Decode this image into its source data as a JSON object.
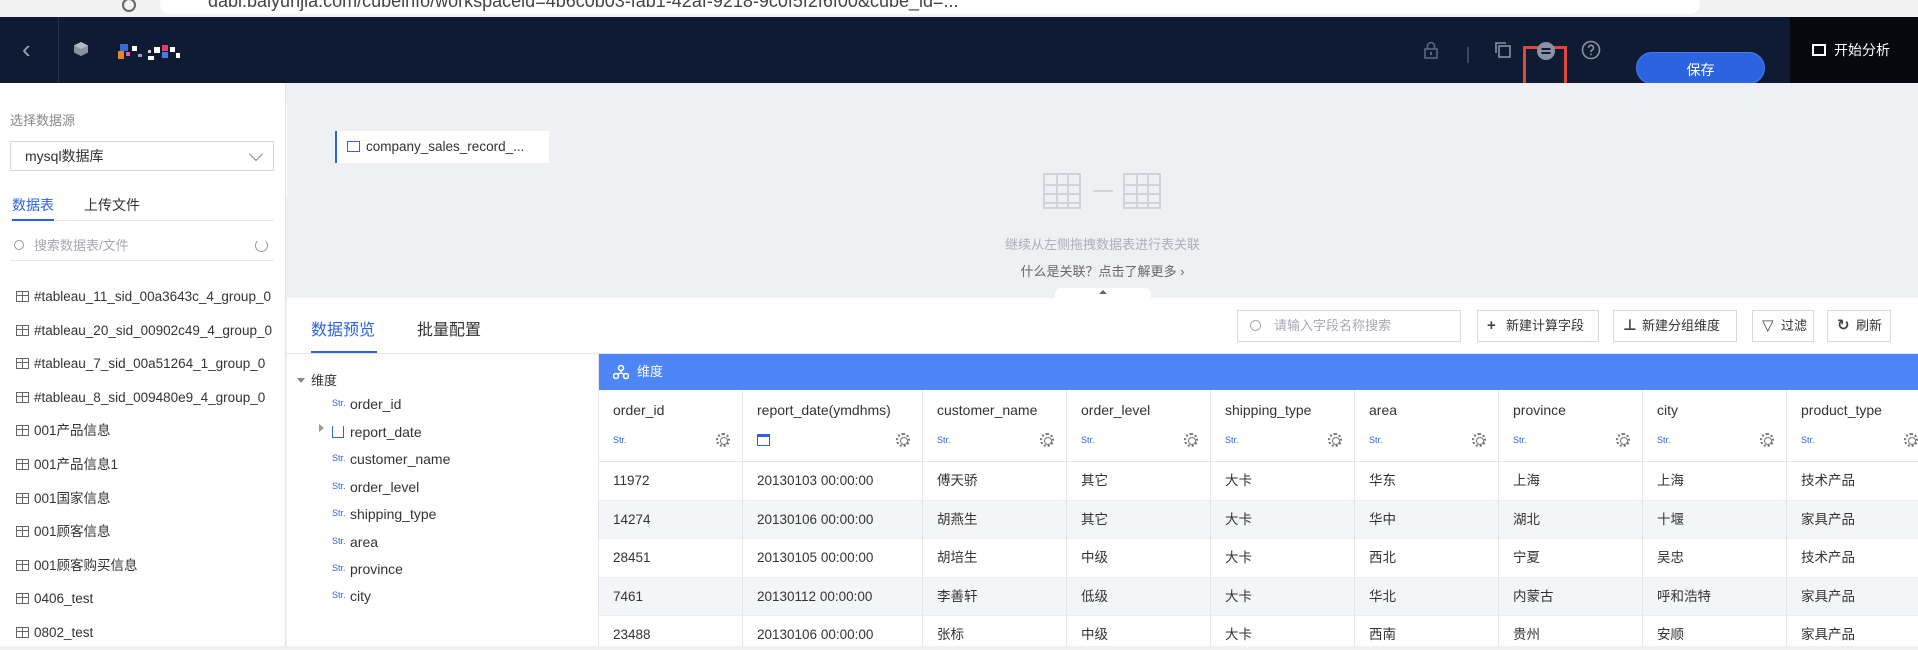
{
  "browser": {
    "url": "dabi.baiyunjia.com/cubeinfo/workspaceid=4b6c0b03-fab1-42af-9218-9c0f5f2f6f00&cube_id=..."
  },
  "topbar": {
    "save_label": "保存",
    "analysis_label": "开始分析",
    "icons": [
      "lock-icon",
      "copy-icon",
      "equals-circle-icon",
      "help-icon"
    ],
    "highlight_color": "#e2483a"
  },
  "left": {
    "datasource_label": "选择数据源",
    "datasource_value": "mysql数据库",
    "tabs": [
      "数据表",
      "上传文件"
    ],
    "search_placeholder": "搜索数据表/文件",
    "tables": [
      "#tableau_11_sid_00a3643c_4_group_0",
      "#tableau_20_sid_00902c49_4_group_0",
      "#tableau_7_sid_00a51264_1_group_0",
      "#tableau_8_sid_009480e9_4_group_0",
      "001产品信息",
      "001产品信息1",
      "001国家信息",
      "001顾客信息",
      "001顾客购买信息",
      "0406_test",
      "0802_test"
    ]
  },
  "canvas": {
    "table_chip": "company_sales_record_...",
    "hint": "继续从左侧拖拽数据表进行表关联",
    "link": "什么是关联？点击了解更多"
  },
  "bottom": {
    "tabs": [
      "数据预览",
      "批量配置"
    ],
    "field_search_placeholder": "请输入字段名称搜索",
    "buttons": [
      "新建计算字段",
      "新建分组维度",
      "过滤",
      "刷新"
    ],
    "dimension_label": "维度",
    "tree_fields": [
      "order_id",
      "report_date",
      "customer_name",
      "order_level",
      "shipping_type",
      "area",
      "province",
      "city"
    ],
    "type_str": "Str.",
    "columns": [
      {
        "name": "order_id",
        "type": "Str."
      },
      {
        "name": "report_date(ymdhms)",
        "type": "date"
      },
      {
        "name": "customer_name",
        "type": "Str."
      },
      {
        "name": "order_level",
        "type": "Str."
      },
      {
        "name": "shipping_type",
        "type": "Str."
      },
      {
        "name": "area",
        "type": "Str."
      },
      {
        "name": "province",
        "type": "Str."
      },
      {
        "name": "city",
        "type": "Str."
      },
      {
        "name": "product_type",
        "type": "Str."
      }
    ],
    "rows": [
      [
        "11972",
        "20130103 00:00:00",
        "傅天骄",
        "其它",
        "大卡",
        "华东",
        "上海",
        "上海",
        "技术产品"
      ],
      [
        "14274",
        "20130106 00:00:00",
        "胡燕生",
        "其它",
        "大卡",
        "华中",
        "湖北",
        "十堰",
        "家具产品"
      ],
      [
        "28451",
        "20130105 00:00:00",
        "胡培生",
        "中级",
        "大卡",
        "西北",
        "宁夏",
        "吴忠",
        "技术产品"
      ],
      [
        "7461",
        "20130112 00:00:00",
        "李善轩",
        "低级",
        "大卡",
        "华北",
        "内蒙古",
        "呼和浩特",
        "家具产品"
      ],
      [
        "23488",
        "20130106 00:00:00",
        "张标",
        "中级",
        "大卡",
        "西南",
        "贵州",
        "安顺",
        "家具产品"
      ]
    ],
    "accent": "#2b63e0",
    "dim_header_color": "#4f86f7"
  }
}
